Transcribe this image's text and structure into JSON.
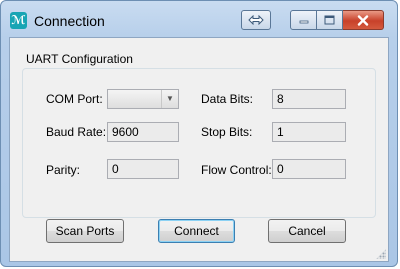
{
  "window": {
    "title": "Connection",
    "icon": "maxim-logo-icon",
    "controls": [
      "swap-arrows-icon",
      "minimize-icon",
      "maximize-icon",
      "close-icon"
    ]
  },
  "uart": {
    "group_label": "UART Configuration",
    "com_port": {
      "label": "COM Port:",
      "value": ""
    },
    "baud_rate": {
      "label": "Baud Rate:",
      "value": "9600"
    },
    "parity": {
      "label": "Parity:",
      "value": "0"
    },
    "data_bits": {
      "label": "Data Bits:",
      "value": "8"
    },
    "stop_bits": {
      "label": "Stop Bits:",
      "value": "1"
    },
    "flow_control": {
      "label": "Flow Control:",
      "value": "0"
    }
  },
  "buttons": {
    "scan_ports": "Scan Ports",
    "connect": "Connect",
    "cancel": "Cancel"
  },
  "colors": {
    "titlebar": "#b7cfea",
    "close_button": "#c8412a",
    "client_bg": "#f0f0f0",
    "logo": "#17a5b4"
  }
}
